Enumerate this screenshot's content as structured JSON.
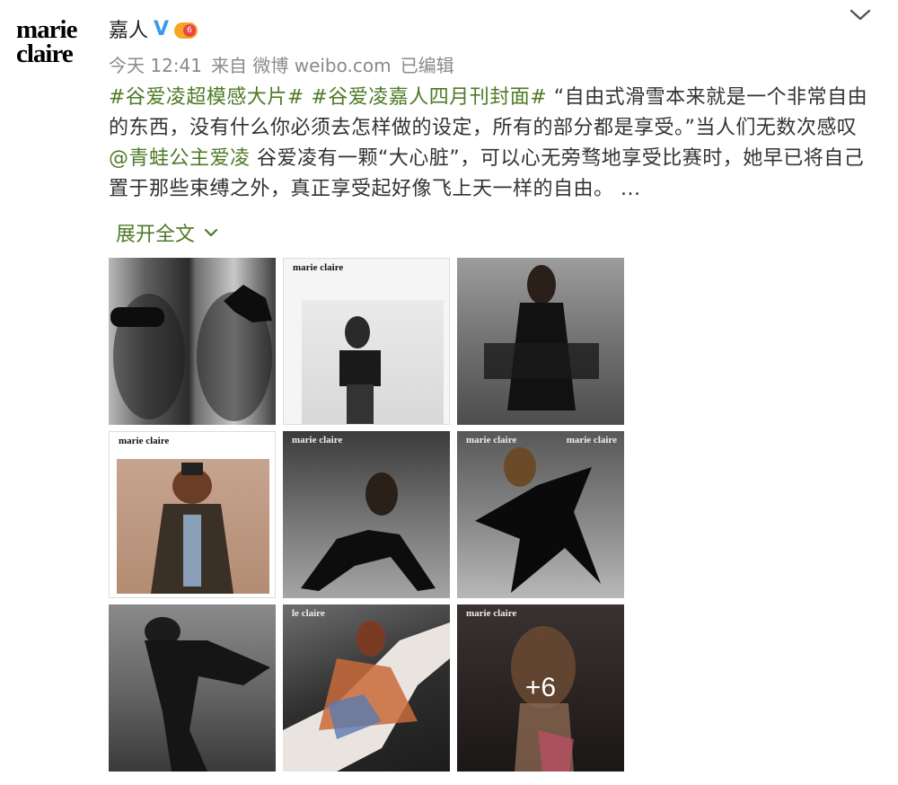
{
  "avatar": {
    "line1": "marie",
    "line2": "claire"
  },
  "user": {
    "name": "嘉人",
    "verified_icon": "V",
    "vip_level": "6"
  },
  "meta": {
    "time": "今天 12:41",
    "source": "来自 微博 weibo.com",
    "edited": "已编辑"
  },
  "post": {
    "topic1": "#谷爱凌超模感大片#",
    "topic2": "#谷爱凌嘉人四月刊封面#",
    "text1": " “自由式滑雪本来就是一个非常自由的东西，没有什么你必须去怎样做的设定，所有的部分都是享受。”当人们无数次感叹",
    "mention": "@青蛙公主爱凌",
    "text2": " 谷爱凌有一颗“大心脏”，可以心无旁骛地享受比赛时，她早已将自己置于那些束缚之外，真正享受起好像飞上天一样的自由。 ..."
  },
  "expand": {
    "label": "展开全文"
  },
  "images": {
    "logo": "marie claire",
    "logo_short": "le claire",
    "more_label": "+6"
  },
  "colors": {
    "link": "#4e7a27",
    "meta": "#8a8a8a",
    "text": "#333333",
    "verified": "#3d9ae8"
  }
}
